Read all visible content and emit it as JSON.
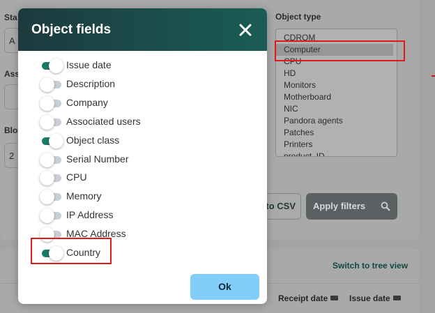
{
  "background": {
    "labels": {
      "status": "Sta",
      "assoc": "Ass",
      "block": "Blo",
      "object_type": "Object type"
    },
    "inputs": {
      "status_value": "A",
      "block_value": "2"
    },
    "object_type_options": [
      "CDROM",
      "Computer",
      "CPU",
      "HD",
      "Monitors",
      "Motherboard",
      "NIC",
      "Pandora agents",
      "Patches",
      "Printers",
      "product_ID"
    ],
    "selected_object_type": "Computer",
    "csv_button": "to CSV",
    "apply_filters_button": "Apply filters",
    "tree_view_link": "Switch to tree view",
    "columns": [
      "Receipt date",
      "Issue date"
    ]
  },
  "modal": {
    "title": "Object fields",
    "fields": [
      {
        "label": "Issue date",
        "enabled": true
      },
      {
        "label": "Description",
        "enabled": false
      },
      {
        "label": "Company",
        "enabled": false
      },
      {
        "label": "Associated users",
        "enabled": false
      },
      {
        "label": "Object class",
        "enabled": true
      },
      {
        "label": "Serial Number",
        "enabled": false
      },
      {
        "label": "CPU",
        "enabled": false
      },
      {
        "label": "Memory",
        "enabled": false
      },
      {
        "label": "IP Address",
        "enabled": false
      },
      {
        "label": "MAC Address",
        "enabled": false
      },
      {
        "label": "Country",
        "enabled": true
      }
    ],
    "ok_button": "Ok"
  },
  "colors": {
    "header_start": "#1d3a3e",
    "header_end": "#1a5d55",
    "toggle_on": "#1d7a68",
    "toggle_off": "#c9cfd9",
    "ok_button": "#82cdf9",
    "highlight_red": "#e01919"
  },
  "icons": {
    "close": "close-icon",
    "search": "search-icon",
    "sort": "sort-icon"
  }
}
